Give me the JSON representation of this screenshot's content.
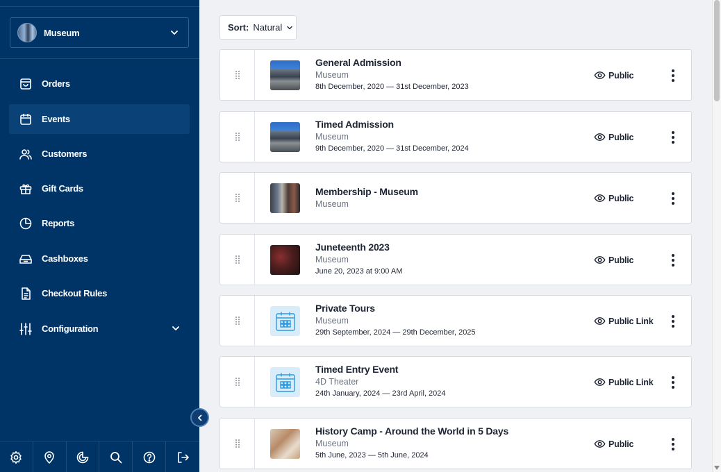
{
  "sidebar": {
    "org_name": "Museum",
    "nav": [
      {
        "label": "Orders",
        "icon": "shopping-bag-icon"
      },
      {
        "label": "Events",
        "icon": "calendar-icon",
        "active": true
      },
      {
        "label": "Customers",
        "icon": "users-icon"
      },
      {
        "label": "Gift Cards",
        "icon": "gift-icon"
      },
      {
        "label": "Reports",
        "icon": "pie-chart-icon"
      },
      {
        "label": "Cashboxes",
        "icon": "cashbox-icon"
      },
      {
        "label": "Checkout Rules",
        "icon": "document-icon"
      },
      {
        "label": "Configuration",
        "icon": "sliders-icon"
      }
    ],
    "bottom_icons": [
      "settings-icon",
      "location-icon",
      "analytics-icon",
      "search-icon",
      "help-icon",
      "logout-icon"
    ]
  },
  "main": {
    "sort": {
      "label": "Sort:",
      "value": "Natural"
    },
    "events": [
      {
        "title": "General Admission",
        "venue": "Museum",
        "dates": "8th December, 2020 — 31st December, 2023",
        "visibility": "Public",
        "thumb": "building"
      },
      {
        "title": "Timed Admission",
        "venue": "Museum",
        "dates": "9th December, 2020 — 31st December, 2024",
        "visibility": "Public",
        "thumb": "building"
      },
      {
        "title": "Membership - Museum",
        "venue": "Museum",
        "dates": "",
        "visibility": "Public",
        "thumb": "membership"
      },
      {
        "title": "Juneteenth 2023",
        "venue": "Museum",
        "dates": "June 20, 2023 at 9:00 AM",
        "visibility": "Public",
        "thumb": "juneteenth"
      },
      {
        "title": "Private Tours",
        "venue": "Museum",
        "dates": "29th September, 2024 — 29th December, 2025",
        "visibility": "Public Link",
        "thumb": "calendar"
      },
      {
        "title": "Timed Entry Event",
        "venue": "4D Theater",
        "dates": "24th January, 2024 — 23rd April, 2024",
        "visibility": "Public Link",
        "thumb": "calendar"
      },
      {
        "title": "History Camp - Around the World in 5 Days",
        "venue": "Museum",
        "dates": "5th June, 2023 — 5th June, 2024",
        "visibility": "Public",
        "thumb": "camp"
      }
    ]
  },
  "colors": {
    "sidebar_bg": "#003466",
    "active_nav_bg": "#0a4278",
    "main_bg": "#f0f1f5",
    "text_dark": "#1d2433",
    "calendar_icon": "#2b9be0"
  }
}
